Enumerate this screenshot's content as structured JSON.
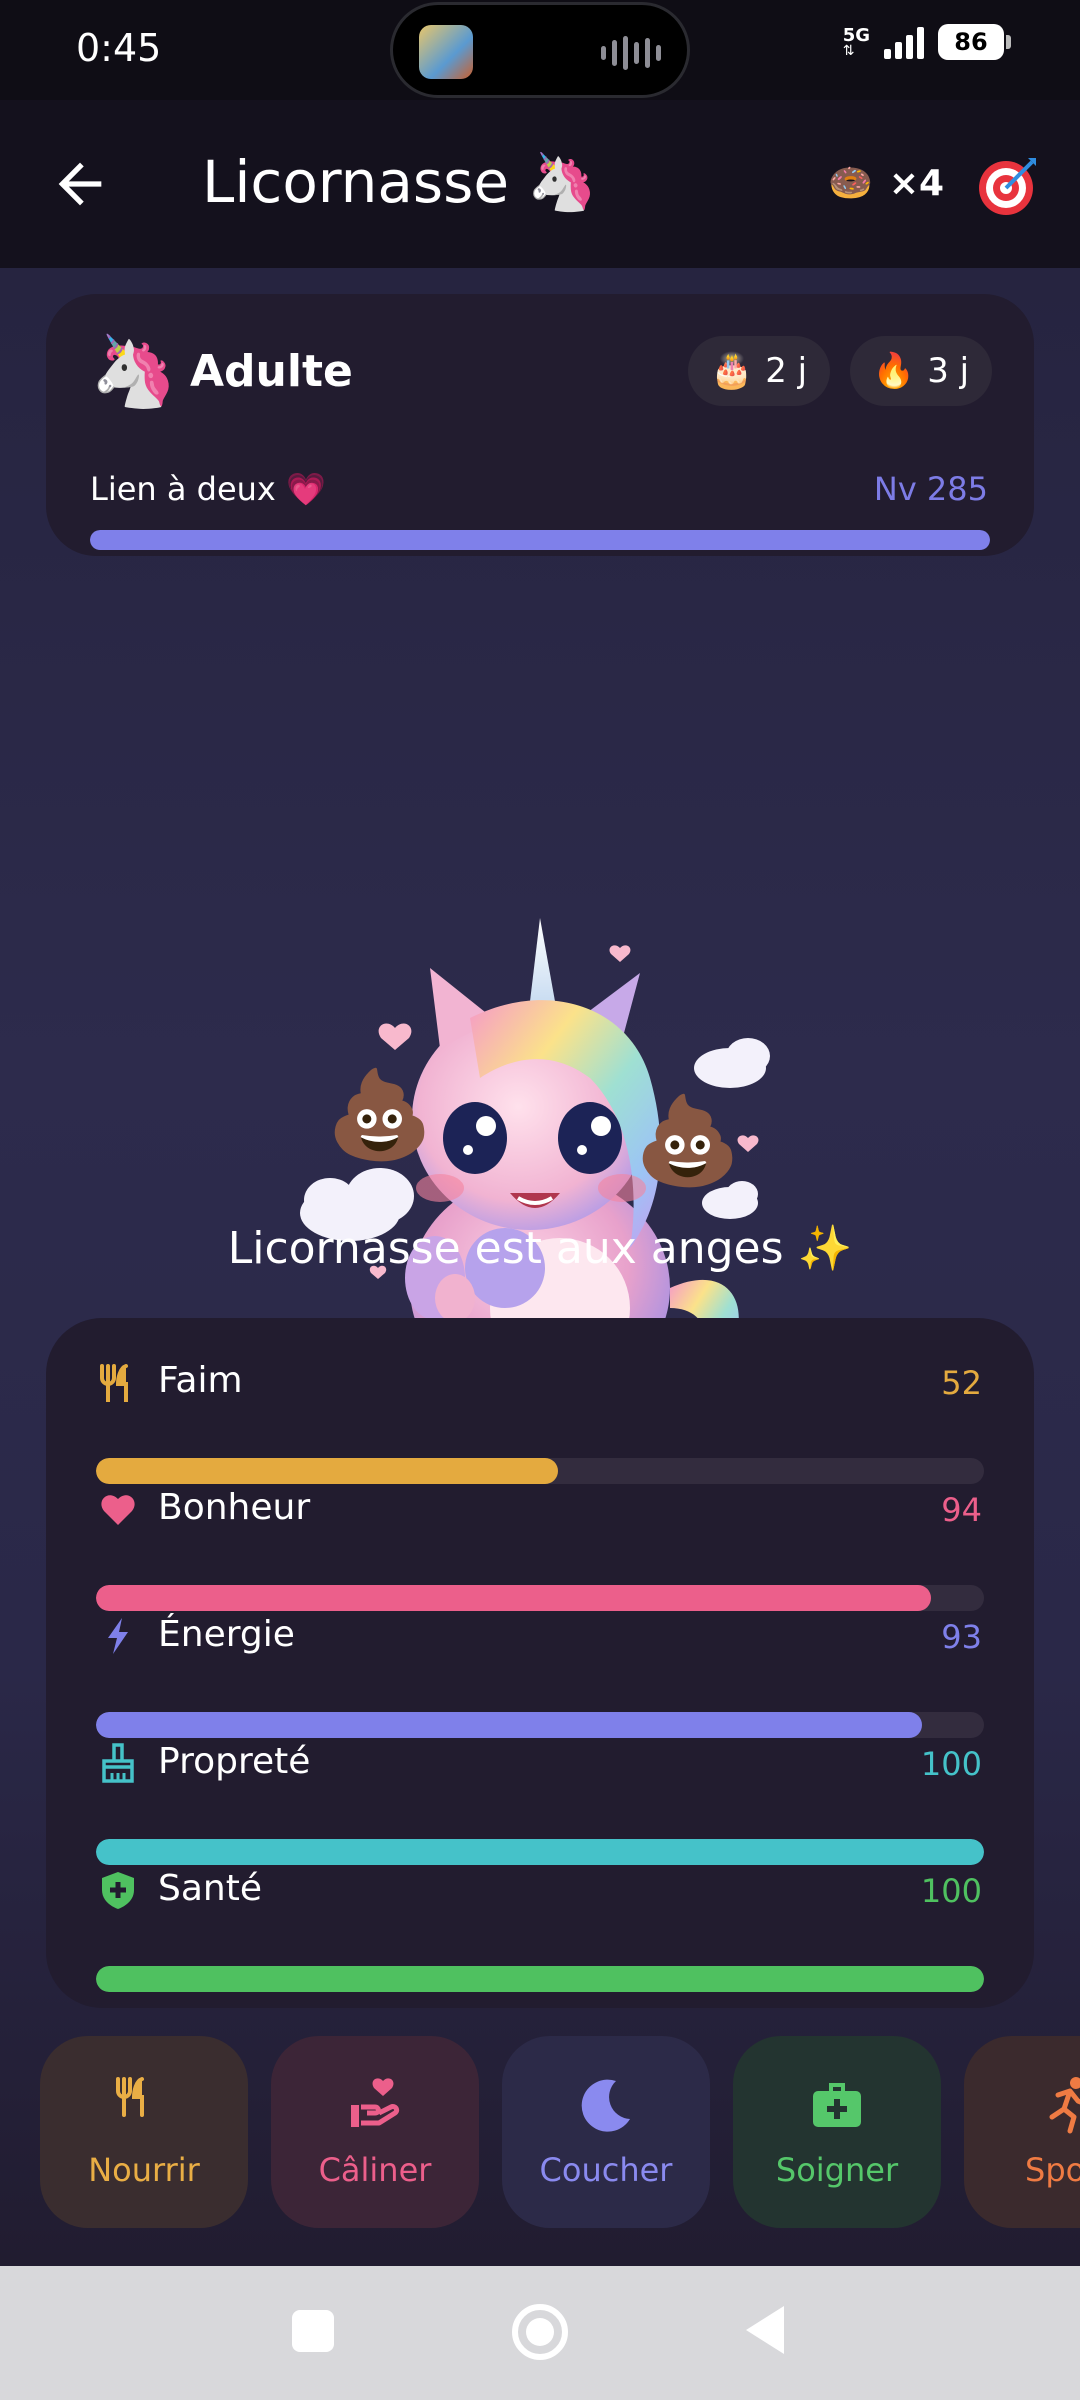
{
  "status_bar": {
    "time": "0:45",
    "network": "5G",
    "battery": "86"
  },
  "header": {
    "back_icon": "arrow-left-icon",
    "title": "Licornasse",
    "title_emoji": "🦄",
    "item_emoji": "🍩",
    "item_count": "×4",
    "goal_icon": "target-icon"
  },
  "profile": {
    "stage_emoji": "🦄",
    "stage": "Adulte",
    "age_emoji": "🎂",
    "age": "2 j",
    "streak_emoji": "🔥",
    "streak": "3 j",
    "bond_label": "Lien à deux 💗",
    "level": "Nv 285",
    "bond_progress": 1.0
  },
  "pet": {
    "mood": "Licornasse est aux anges ✨",
    "poop_emoji": "💩"
  },
  "stats": [
    {
      "label": "Faim",
      "value": "52",
      "icon": "fork-knife-icon",
      "color": "#e4aa3f"
    },
    {
      "label": "Bonheur",
      "value": "94",
      "icon": "heart-icon",
      "color": "#ec5f8b"
    },
    {
      "label": "Énergie",
      "value": "93",
      "icon": "bolt-icon",
      "color": "#7f80ea"
    },
    {
      "label": "Propreté",
      "value": "100",
      "icon": "brush-icon",
      "color": "#45c2c9"
    },
    {
      "label": "Santé",
      "value": "100",
      "icon": "shield-plus-icon",
      "color": "#4fc160"
    }
  ],
  "actions": [
    {
      "label": "Nourrir",
      "icon": "fork-knife-icon",
      "color": "#e9ae45",
      "bg": "#3a2d2f"
    },
    {
      "label": "Câliner",
      "icon": "hand-heart-icon",
      "color": "#ec5f8b",
      "bg": "#3c2537"
    },
    {
      "label": "Coucher",
      "icon": "moon-icon",
      "color": "#8a8aef",
      "bg": "#2c2a48"
    },
    {
      "label": "Soigner",
      "icon": "medkit-icon",
      "color": "#55c76a",
      "bg": "#233430"
    },
    {
      "label": "Sport",
      "icon": "runner-icon",
      "color": "#ef7b43",
      "bg": "#3b2a2d"
    }
  ]
}
